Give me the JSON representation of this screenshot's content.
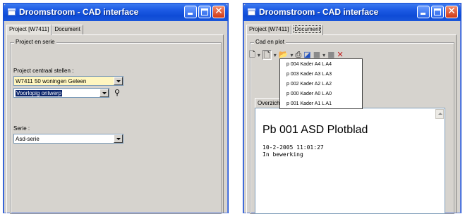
{
  "left_window": {
    "title": "Droomstroom - CAD interface",
    "tabs": [
      "Project [W7411]",
      "Document"
    ],
    "group_title": "Project en serie",
    "project_label": "Project centraal stellen :",
    "project_value": "W7411 50 woningen Geleen",
    "status_value": "Voorlopig ontwerp",
    "serie_label": "Serie :",
    "serie_value": "Asd-serie"
  },
  "right_window": {
    "title": "Droomstroom - CAD interface",
    "tabs": [
      "Project [W7411]",
      "Document"
    ],
    "group_title": "Cad en plot",
    "dropdown_items": [
      "p 004 Kader A4 L A4",
      "p 003 Kader A3 L A3",
      "p 002 Kader A2 L A2",
      "p 000 Kader A0 L A0",
      "p 001 Kader A1 L A1"
    ],
    "overview_tab": "Overzicht",
    "plot_title": "Pb 001 ASD Plotblad",
    "plot_date": "10-2-2005 11:01:27",
    "plot_status": "In bewerking"
  }
}
